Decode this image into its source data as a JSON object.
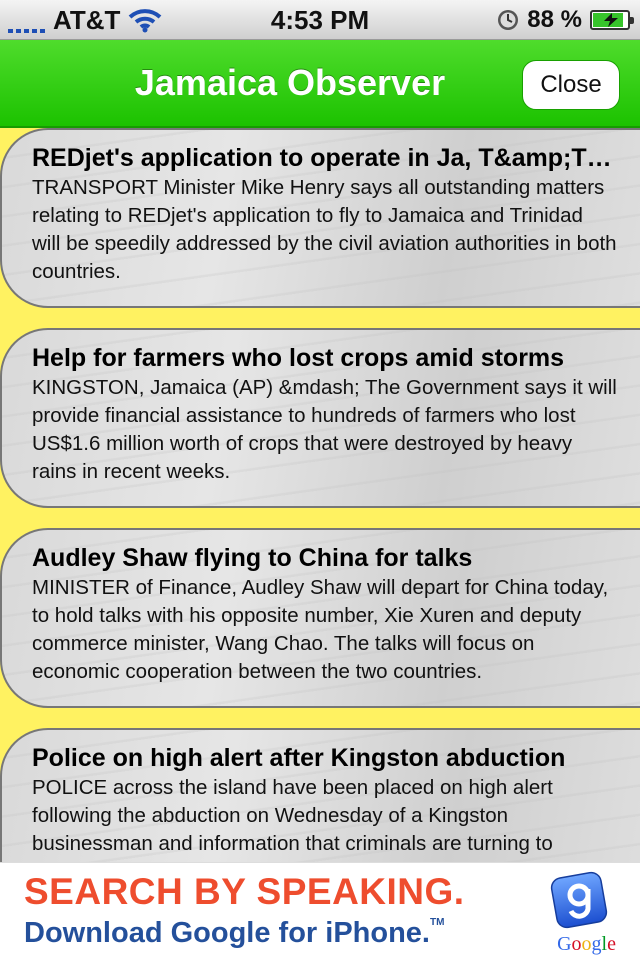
{
  "status_bar": {
    "carrier": "AT&T",
    "time": "4:53 PM",
    "battery_pct": "88 %",
    "battery_level": 0.88,
    "icons": [
      "signal-icon",
      "wifi-icon",
      "clock-icon",
      "battery-icon"
    ]
  },
  "nav": {
    "title": "Jamaica Observer",
    "close_label": "Close"
  },
  "articles": [
    {
      "title": "REDjet's application to operate in Ja, T&amp;T to be dealt with",
      "body": "TRANSPORT Minister Mike Henry says all outstanding matters relating to REDjet's application to fly to Jamaica and Trinidad will be speedily addressed by the civil aviation authorities in both countries."
    },
    {
      "title": "Help for farmers who lost crops amid storms",
      "body": "KINGSTON, Jamaica (AP) &mdash; The Government says it will provide financial assistance to hundreds of farmers who lost US$1.6 million worth of crops that were destroyed by heavy rains in recent weeks."
    },
    {
      "title": "Audley Shaw flying to China for talks",
      "body": "MINISTER of Finance, Audley Shaw will depart for China today, to hold talks with his opposite number, Xie Xuren and deputy commerce minister, Wang Chao. The talks will focus on economic cooperation between the two countries."
    },
    {
      "title": "Police on high alert after Kingston abduction",
      "body": "POLICE across the island have been placed on high alert following the abduction on Wednesday of a Kingston businessman and information that criminals are turning to kidnapping after security forces' successes."
    }
  ],
  "ad": {
    "line1": "SEARCH BY SPEAKING.",
    "line2": "Download Google for iPhone.",
    "tm": "TM",
    "brand": "Google",
    "brand_colors": [
      "#3369e8",
      "#d50f25",
      "#eeb211",
      "#3369e8",
      "#009925",
      "#d50f25"
    ]
  }
}
